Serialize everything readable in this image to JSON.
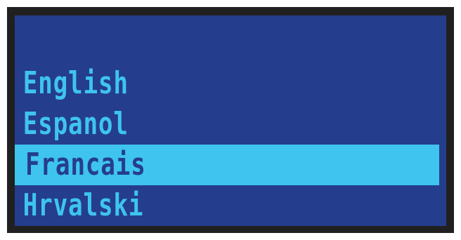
{
  "menu": {
    "items": [
      {
        "label": "English",
        "selected": false
      },
      {
        "label": "Espanol",
        "selected": false
      },
      {
        "label": "Francais",
        "selected": true
      },
      {
        "label": "Hrvalski",
        "selected": false
      }
    ]
  },
  "colors": {
    "screen_background": "#253d8d",
    "text": "#3ec4ef",
    "highlight": "#3ec4ef",
    "highlight_text": "#253d8d",
    "bezel": "#202020"
  }
}
